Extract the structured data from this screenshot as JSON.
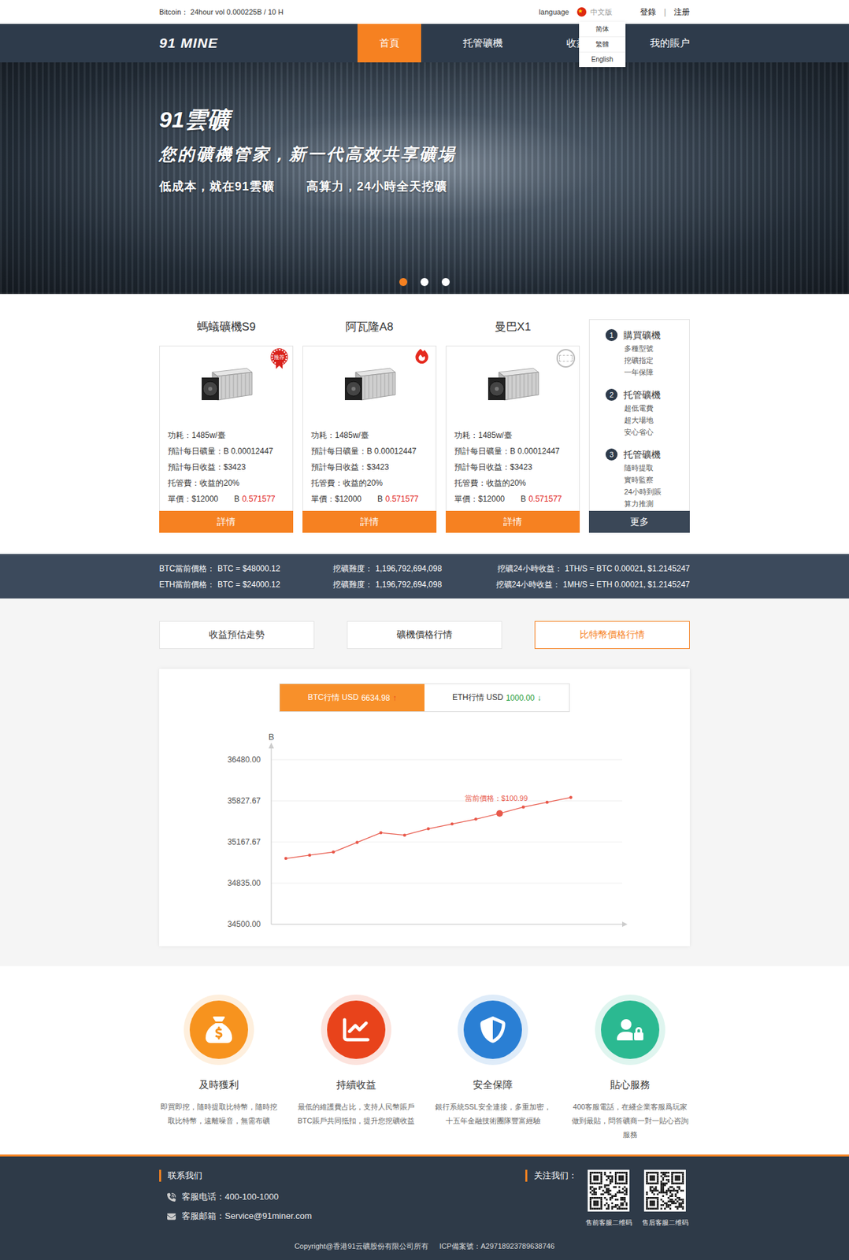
{
  "top_bar": {
    "ticker": "Bitcoin： 24hour vol 0.000225B / 10 H",
    "language_label": "language",
    "language_current": "中文版",
    "language_menu": {
      "expanded": true,
      "options": [
        {
          "label": "简体"
        },
        {
          "label": "繁體"
        },
        {
          "label": "English"
        }
      ]
    },
    "login": "登錄",
    "separator": "|",
    "register": "注册"
  },
  "nav": {
    "logo": "91 MINE",
    "items": [
      {
        "label": "首頁",
        "selected": true
      },
      {
        "label": "托管礦機",
        "selected": false
      },
      {
        "label": "收益",
        "selected": false
      },
      {
        "label": "我的賬户",
        "selected": false
      }
    ]
  },
  "hero": {
    "title": "91雲礦",
    "subtitle": "您的礦機管家，新一代高效共享礦場",
    "taglines": [
      "低成本，就在91雲礦",
      "高算力，24小時全天挖礦"
    ],
    "dots": [
      {
        "selected": true
      },
      {
        "selected": false
      },
      {
        "selected": false
      }
    ]
  },
  "products": [
    {
      "name": "螞蟻礦機S9",
      "badge": {
        "kind": "recommend",
        "text": "推荐"
      },
      "specs": [
        "功耗：1485w/臺",
        "預計每日礦量：B 0.00012447",
        "預計每日收益：$3423",
        "托管費：收益的20%"
      ],
      "price": "單價：$12000",
      "price_symbol": "B",
      "price_btc": "0.571577",
      "button": "詳情"
    },
    {
      "name": "阿瓦隆A8",
      "badge": {
        "kind": "hot",
        "text": ""
      },
      "specs": [
        "功耗：1485w/臺",
        "預計每日礦量：B 0.00012447",
        "預計每日收益：$3423",
        "托管費：收益的20%"
      ],
      "price": "單價：$12000",
      "price_symbol": "B",
      "price_btc": "0.571577",
      "button": "詳情"
    },
    {
      "name": "曼巴X1",
      "badge": {
        "kind": "stamp",
        "text": ""
      },
      "specs": [
        "功耗：1485w/臺",
        "預計每日礦量：B 0.00012447",
        "預計每日收益：$3423",
        "托管費：收益的20%"
      ],
      "price": "單價：$12000",
      "price_symbol": "B",
      "price_btc": "0.571577",
      "button": "詳情"
    }
  ],
  "steps": {
    "items": [
      {
        "number": "1",
        "title": "購買礦機",
        "points": [
          "多種型號",
          "挖礦指定",
          "一年保障"
        ]
      },
      {
        "number": "2",
        "title": "托管礦機",
        "points": [
          "超低電費",
          "超大場地",
          "安心省心"
        ]
      },
      {
        "number": "3",
        "title": "托管礦機",
        "points": [
          "隨時提取",
          "實時監察",
          "24小時到賬",
          "算力推測"
        ]
      }
    ],
    "button": "更多"
  },
  "stats": [
    [
      {
        "label": "BTC當前價格：",
        "value": "BTC = $48000.12"
      },
      {
        "label": "挖礦難度：",
        "value": "1,196,792,694,098"
      },
      {
        "label": "挖礦24小時收益：",
        "value": "1TH/S = BTC 0.00021, $1.2145247"
      }
    ],
    [
      {
        "label": "ETH當前價格：",
        "value": "BTC = $24000.12"
      },
      {
        "label": "挖礦難度：",
        "value": "1,196,792,694,098"
      },
      {
        "label": "挖礦24小時收益：",
        "value": "1MH/S = ETH 0.00021, $1.2145247"
      }
    ]
  ],
  "market_tabs": [
    {
      "label": "收益預估走勢",
      "selected": false
    },
    {
      "label": "礦機價格行情",
      "selected": false
    },
    {
      "label": "比特幣價格行情",
      "selected": true
    }
  ],
  "chart": {
    "toggles": [
      {
        "label": "BTC行情 USD",
        "value": "6634.98",
        "arrow": "↑",
        "trend_color": "#e8431b",
        "selected": true
      },
      {
        "label": "ETH行情 USD",
        "value": "1000.00",
        "arrow": "↓",
        "trend_color": "#1f9d3a",
        "selected": false
      }
    ],
    "y_label": "B",
    "ticks": [
      "36480.00",
      "35827.67",
      "35167.67",
      "34835.00",
      "34500.00"
    ],
    "y_min": 34500,
    "y_max": 36480,
    "values": [
      35292,
      35331,
      35369,
      35485,
      35601,
      35572,
      35649,
      35707,
      35765,
      35833,
      35910,
      35968,
      36026
    ],
    "highlight_index": 9,
    "tooltip": "當前價格：$100.99"
  },
  "features": [
    {
      "title": "及時獲利",
      "text": "即買即挖，隨時提取比特幣，隨時挖取比特幣，遠離噪音，無需布礦",
      "color": "#f7931e"
    },
    {
      "title": "持續收益",
      "text": "最低的維護費占比，支持人民幣賬戶 BTC賬戶共同抵扣，提升您挖礦收益",
      "color": "#e8431b"
    },
    {
      "title": "安全保障",
      "text": "銀行系統SSL安全連接，多重加密，十五年金融技術團隊豐富經驗",
      "color": "#2a7fd4"
    },
    {
      "title": "貼心服務",
      "text": "400客服電話，在綫企業客服爲玩家做到最貼，問答礦商一對一貼心咨詢服務",
      "color": "#2bb991"
    }
  ],
  "footer": {
    "contact_title": "联系我们",
    "phone": "客服电话：400-100-1000",
    "email": "客服邮箱：Service@91miner.com",
    "follow_title": "关注我们：",
    "qr_codes": [
      {
        "caption": "售前客服二维码"
      },
      {
        "caption": "售后客服二维码"
      }
    ],
    "copyright": "Copyright@香港91云礦股份有限公司所有",
    "icp": "ICP備案號：A29718923789638746"
  }
}
